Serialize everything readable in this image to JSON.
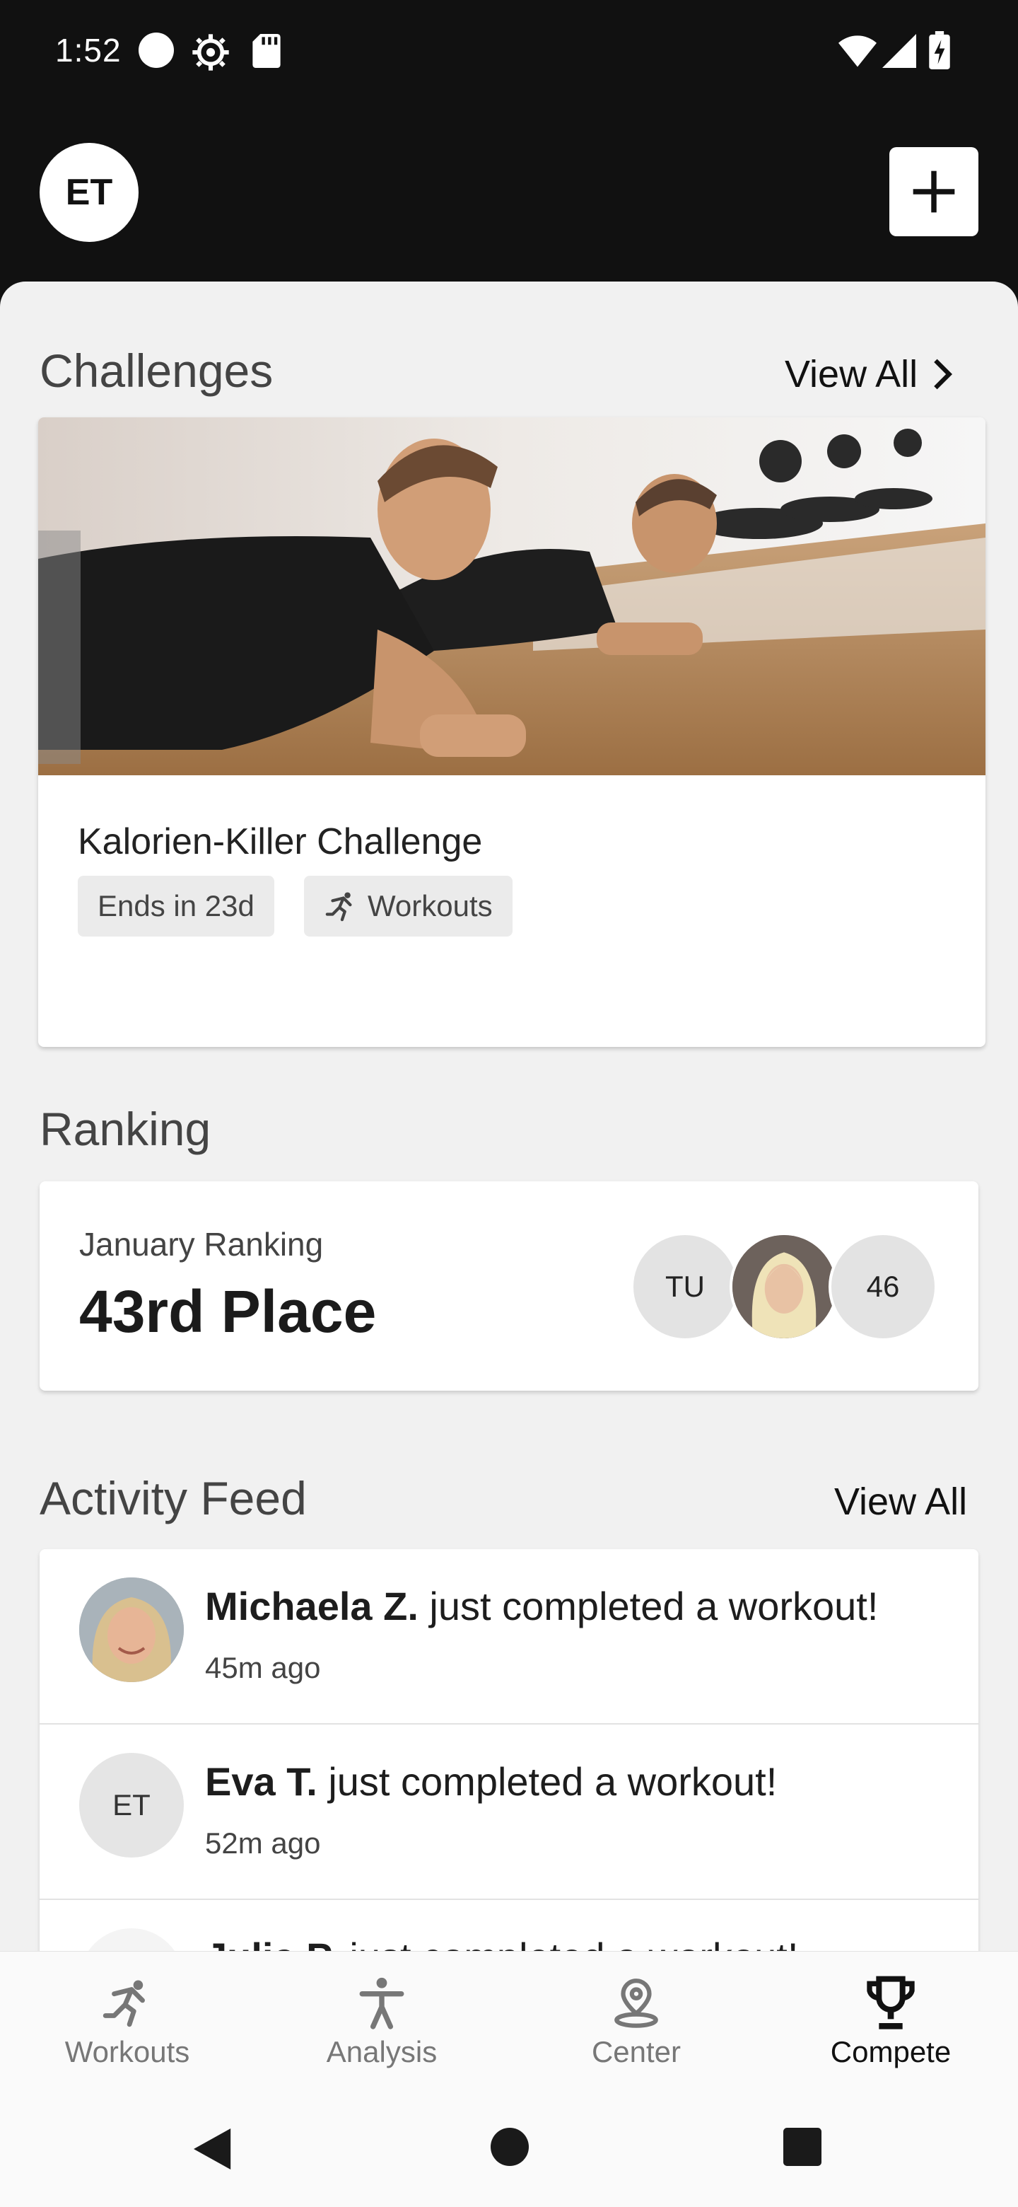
{
  "status_bar": {
    "time": "1:52"
  },
  "header": {
    "avatar_initials": "ET"
  },
  "challenges": {
    "title": "Challenges",
    "view_all": "View All",
    "card": {
      "title": "Kalorien-Killer Challenge",
      "chip_ends": "Ends in 23d",
      "chip_type": "Workouts"
    }
  },
  "ranking": {
    "title": "Ranking",
    "subtitle": "January Ranking",
    "place": "43rd Place",
    "avatars": [
      "TU",
      "46"
    ]
  },
  "activity": {
    "title": "Activity Feed",
    "view_all": "View All",
    "items": [
      {
        "name": "Michaela Z.",
        "text": " just completed a workout!",
        "time": "45m ago",
        "initials": ""
      },
      {
        "name": "Eva T.",
        "text": " just completed a workout!",
        "time": "52m ago",
        "initials": "ET"
      },
      {
        "name": "Julia P.",
        "text": " just completed a workout!",
        "time": "",
        "initials": ""
      }
    ]
  },
  "bottom_nav": {
    "items": [
      {
        "label": "Workouts",
        "icon": "running-person-icon"
      },
      {
        "label": "Analysis",
        "icon": "person-figure-icon"
      },
      {
        "label": "Center",
        "icon": "location-pin-icon"
      },
      {
        "label": "Compete",
        "icon": "trophy-icon",
        "active": true
      }
    ]
  }
}
